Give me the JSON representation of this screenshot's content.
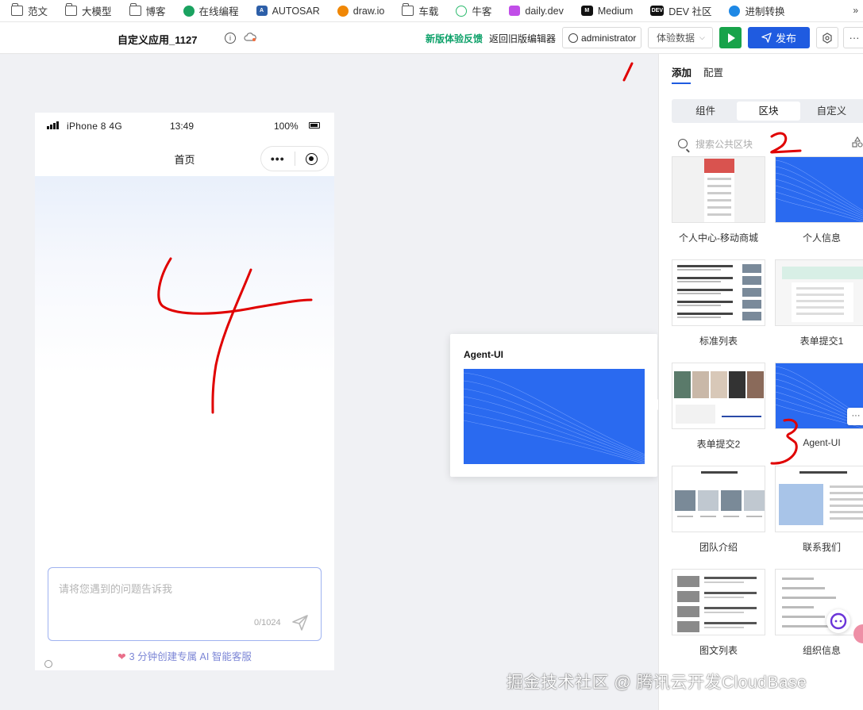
{
  "bookmarks": [
    {
      "label": "范文",
      "icon": "folder-icon"
    },
    {
      "label": "大模型",
      "icon": "folder-icon"
    },
    {
      "label": "博客",
      "icon": "folder-icon"
    },
    {
      "label": "在线编程",
      "icon": "code-site-icon"
    },
    {
      "label": "AUTOSAR",
      "icon": "autosar-icon"
    },
    {
      "label": "draw.io",
      "icon": "drawio-icon"
    },
    {
      "label": "车载",
      "icon": "folder-icon"
    },
    {
      "label": "牛客",
      "icon": "nowcoder-icon"
    },
    {
      "label": "daily.dev",
      "icon": "dailydev-icon"
    },
    {
      "label": "Medium",
      "icon": "medium-icon"
    },
    {
      "label": "DEV 社区",
      "icon": "dev-icon"
    },
    {
      "label": "进制转换",
      "icon": "converter-icon"
    }
  ],
  "bookmarks_more": "»",
  "toolbar": {
    "app_name": "自定义应用_1127",
    "feedback_label": "新版体验反馈",
    "legacy_editor_label": "返回旧版编辑器",
    "user_label": "administrator",
    "data_select_value": "体验数据",
    "publish_label": "发布",
    "more_label": "···"
  },
  "phone": {
    "carrier": "iPhone 8  4G",
    "time": "13:49",
    "battery": "100%",
    "page_title": "首页",
    "capsule_dots": "•••",
    "input_placeholder": "请将您遇到的问题告诉我",
    "char_counter": "0/1024",
    "promo_heart": "❤",
    "promo_text": "3 分钟创建专属 AI 智能客服"
  },
  "hover_preview": {
    "title": "Agent-UI"
  },
  "panel": {
    "tabs": [
      {
        "label": "添加",
        "active": true
      },
      {
        "label": "配置",
        "active": false
      }
    ],
    "segments": [
      {
        "label": "组件",
        "active": false
      },
      {
        "label": "区块",
        "active": true
      },
      {
        "label": "自定义",
        "active": false
      }
    ],
    "search_placeholder": "搜索公共区块",
    "blocks": [
      {
        "label": "个人中心-移动商城",
        "thumb": "mobile-mall"
      },
      {
        "label": "个人信息",
        "thumb": "blue-wave"
      },
      {
        "label": "标准列表",
        "thumb": "list"
      },
      {
        "label": "表单提交1",
        "thumb": "form"
      },
      {
        "label": "表单提交2",
        "thumb": "photo-grid"
      },
      {
        "label": "Agent-UI",
        "thumb": "blue-wave",
        "more": "···"
      },
      {
        "label": "团队介绍",
        "thumb": "team"
      },
      {
        "label": "联系我们",
        "thumb": "contact"
      },
      {
        "label": "图文列表",
        "thumb": "image-text"
      },
      {
        "label": "组织信息",
        "thumb": "org"
      }
    ]
  },
  "annotations": [
    "1",
    "2",
    "3",
    "4"
  ],
  "watermark": "掘金技术社区 @ 腾讯云开发CloudBase",
  "colors": {
    "primary": "#1f5be0",
    "run": "#17a34a",
    "feedback": "#10a26b",
    "annotation": "#e00000"
  }
}
